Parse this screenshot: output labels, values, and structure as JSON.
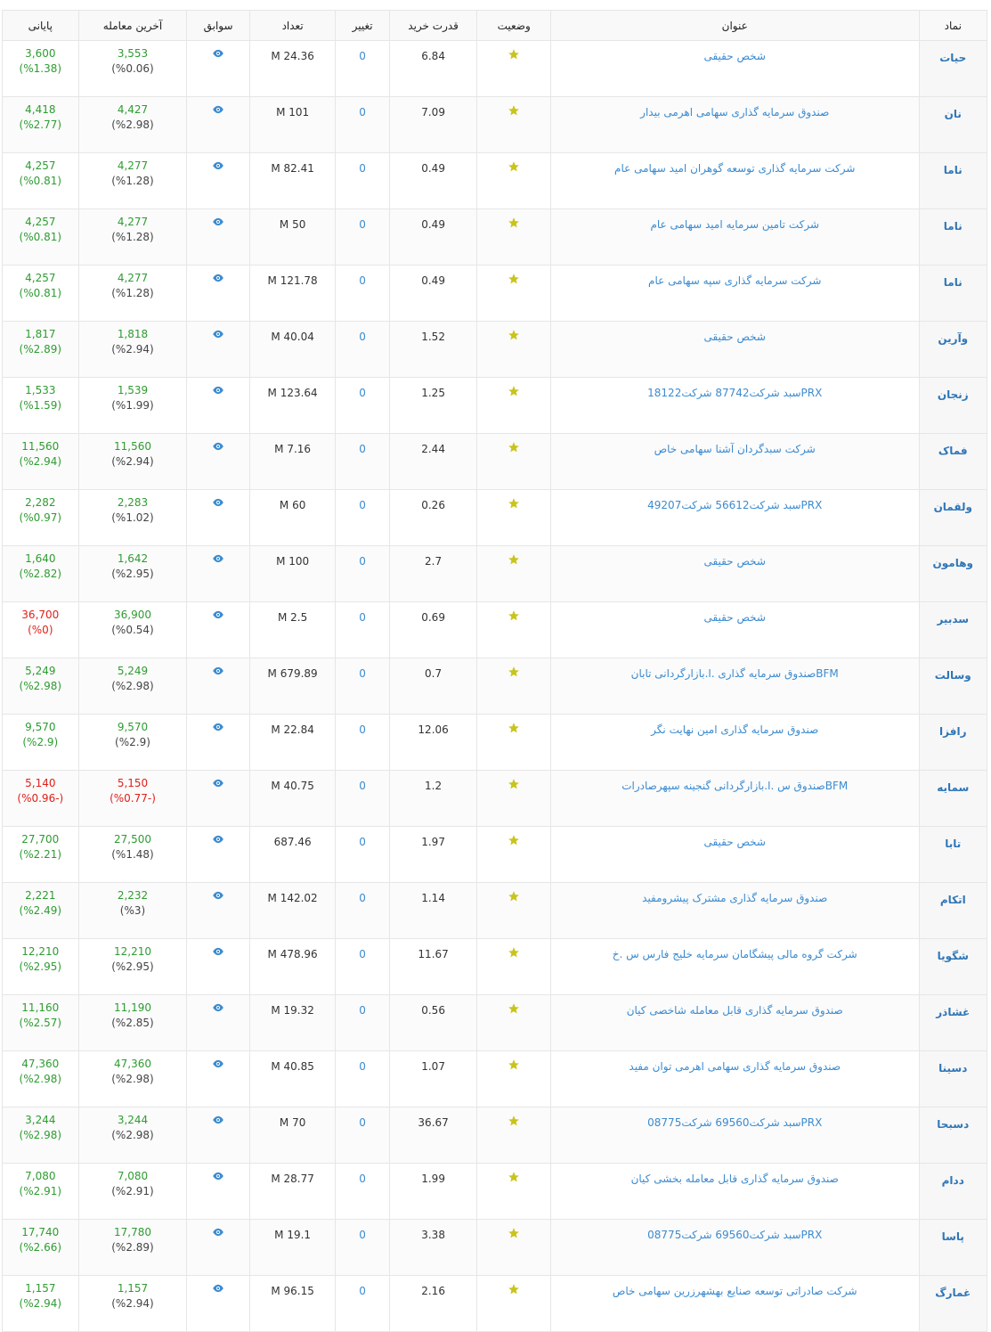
{
  "columns": {
    "symbol": "نماد",
    "title": "عنوان",
    "status": "وضعیت",
    "buy_power": "قدرت خرید",
    "change": "تغییر",
    "count": "تعداد",
    "history": "سوابق",
    "last_trade": "آخرین معامله",
    "closing": "پایانی"
  },
  "icons": {
    "status": "star-icon",
    "history": "eye-icon"
  },
  "colors": {
    "positive": "#2e9c31",
    "negative": "#e0201a",
    "link": "#3b8bd0",
    "star": "#c8c41a"
  },
  "rows": [
    {
      "symbol": "حیات",
      "title": "شخص حقیقی",
      "buy_power": "6.84",
      "change": "0",
      "count": "24.36 M",
      "last": "3,553",
      "last_pct": "(%0.06)",
      "close": "3,600",
      "close_pct": "(%1.38)",
      "close_sign": "pos"
    },
    {
      "symbol": "نان",
      "title": "صندوق سرمایه گذاری سهامی اهرمی بیدار",
      "buy_power": "7.09",
      "change": "0",
      "count": "101 M",
      "last": "4,427",
      "last_pct": "(%2.98)",
      "close": "4,418",
      "close_pct": "(%2.77)",
      "close_sign": "pos"
    },
    {
      "symbol": "ناما",
      "title": "شرکت سرمایه گذاری توسعه گوهران امید سهامی عام",
      "buy_power": "0.49",
      "change": "0",
      "count": "82.41 M",
      "last": "4,277",
      "last_pct": "(%1.28)",
      "close": "4,257",
      "close_pct": "(%0.81)",
      "close_sign": "pos"
    },
    {
      "symbol": "ناما",
      "title": "شرکت تامین سرمایه امید سهامی عام",
      "buy_power": "0.49",
      "change": "0",
      "count": "50 M",
      "last": "4,277",
      "last_pct": "(%1.28)",
      "close": "4,257",
      "close_pct": "(%0.81)",
      "close_sign": "pos"
    },
    {
      "symbol": "ناما",
      "title": "شرکت سرمایه گذاری سپه سهامی عام",
      "buy_power": "0.49",
      "change": "0",
      "count": "121.78 M",
      "last": "4,277",
      "last_pct": "(%1.28)",
      "close": "4,257",
      "close_pct": "(%0.81)",
      "close_sign": "pos"
    },
    {
      "symbol": "وآرین",
      "title": "شخص حقیقی",
      "buy_power": "1.52",
      "change": "0",
      "count": "40.04 M",
      "last": "1,818",
      "last_pct": "(%2.94)",
      "close": "1,817",
      "close_pct": "(%2.89)",
      "close_sign": "pos"
    },
    {
      "symbol": "زنجان",
      "title": "PRXسبد شرکت87742 شرکت18122",
      "buy_power": "1.25",
      "change": "0",
      "count": "123.64 M",
      "last": "1,539",
      "last_pct": "(%1.99)",
      "close": "1,533",
      "close_pct": "(%1.59)",
      "close_sign": "pos"
    },
    {
      "symbol": "فماک",
      "title": "شرکت سبدگردان آشنا سهامی خاص",
      "buy_power": "2.44",
      "change": "0",
      "count": "7.16 M",
      "last": "11,560",
      "last_pct": "(%2.94)",
      "close": "11,560",
      "close_pct": "(%2.94)",
      "close_sign": "pos"
    },
    {
      "symbol": "ولقمان",
      "title": "PRXسبد شرکت56612 شرکت49207",
      "buy_power": "0.26",
      "change": "0",
      "count": "60 M",
      "last": "2,283",
      "last_pct": "(%1.02)",
      "close": "2,282",
      "close_pct": "(%0.97)",
      "close_sign": "pos"
    },
    {
      "symbol": "وهامون",
      "title": "شخص حقیقی",
      "buy_power": "2.7",
      "change": "0",
      "count": "100 M",
      "last": "1,642",
      "last_pct": "(%2.95)",
      "close": "1,640",
      "close_pct": "(%2.82)",
      "close_sign": "pos"
    },
    {
      "symbol": "سدبیر",
      "title": "شخص حقیقی",
      "buy_power": "0.69",
      "change": "0",
      "count": "2.5 M",
      "last": "36,900",
      "last_pct": "(%0.54)",
      "close": "36,700",
      "close_pct": "(%0)",
      "close_sign": "neg"
    },
    {
      "symbol": "وسالت",
      "title": "BFMصندوق سرمایه گذاری .ا.بازارگردانی تابان",
      "buy_power": "0.7",
      "change": "0",
      "count": "679.89 M",
      "last": "5,249",
      "last_pct": "(%2.98)",
      "close": "5,249",
      "close_pct": "(%2.98)",
      "close_sign": "pos"
    },
    {
      "symbol": "رافزا",
      "title": "صندوق سرمایه گذاری امین نهایت نگر",
      "buy_power": "12.06",
      "change": "0",
      "count": "22.84 M",
      "last": "9,570",
      "last_pct": "(%2.9)",
      "close": "9,570",
      "close_pct": "(%2.9)",
      "close_sign": "pos"
    },
    {
      "symbol": "سمایه",
      "title": "BFMصندوق س .ا.بازارگردانی گنجینه سپهرصادرات",
      "buy_power": "1.2",
      "change": "0",
      "count": "40.75 M",
      "last": "5,150",
      "last_pct": "(-%0.77)",
      "close": "5,140",
      "close_pct": "(-%0.96)",
      "close_sign": "neg",
      "last_sign": "neg"
    },
    {
      "symbol": "تابا",
      "title": "شخص حقیقی",
      "buy_power": "1.97",
      "change": "0",
      "count": "687.46",
      "last": "27,500",
      "last_pct": "(%1.48)",
      "close": "27,700",
      "close_pct": "(%2.21)",
      "close_sign": "pos"
    },
    {
      "symbol": "اتکام",
      "title": "صندوق سرمایه گذاری مشترک پیشرومفید",
      "buy_power": "1.14",
      "change": "0",
      "count": "142.02 M",
      "last": "2,232",
      "last_pct": "(%3)",
      "close": "2,221",
      "close_pct": "(%2.49)",
      "close_sign": "pos"
    },
    {
      "symbol": "شگویا",
      "title": "شرکت گروه مالی پیشگامان سرمایه خلیج فارس س .خ",
      "buy_power": "11.67",
      "change": "0",
      "count": "478.96 M",
      "last": "12,210",
      "last_pct": "(%2.95)",
      "close": "12,210",
      "close_pct": "(%2.95)",
      "close_sign": "pos"
    },
    {
      "symbol": "غشاذر",
      "title": "صندوق سرمایه گذاری قابل معامله شاخصی کیان",
      "buy_power": "0.56",
      "change": "0",
      "count": "19.32 M",
      "last": "11,190",
      "last_pct": "(%2.85)",
      "close": "11,160",
      "close_pct": "(%2.57)",
      "close_sign": "pos"
    },
    {
      "symbol": "دسینا",
      "title": "صندوق سرمایه گذاری سهامی اهرمی توان مفید",
      "buy_power": "1.07",
      "change": "0",
      "count": "40.85 M",
      "last": "47,360",
      "last_pct": "(%2.98)",
      "close": "47,360",
      "close_pct": "(%2.98)",
      "close_sign": "pos"
    },
    {
      "symbol": "دسبحا",
      "title": "PRXسبد شرکت69560 شرکت08775",
      "buy_power": "36.67",
      "change": "0",
      "count": "70 M",
      "last": "3,244",
      "last_pct": "(%2.98)",
      "close": "3,244",
      "close_pct": "(%2.98)",
      "close_sign": "pos"
    },
    {
      "symbol": "ددام",
      "title": "صندوق سرمایه گذاری قابل معامله بخشی کیان",
      "buy_power": "1.99",
      "change": "0",
      "count": "28.77 M",
      "last": "7,080",
      "last_pct": "(%2.91)",
      "close": "7,080",
      "close_pct": "(%2.91)",
      "close_sign": "pos"
    },
    {
      "symbol": "پاسا",
      "title": "PRXسبد شرکت69560 شرکت08775",
      "buy_power": "3.38",
      "change": "0",
      "count": "19.1 M",
      "last": "17,780",
      "last_pct": "(%2.89)",
      "close": "17,740",
      "close_pct": "(%2.66)",
      "close_sign": "pos"
    },
    {
      "symbol": "غمارگ",
      "title": "شرکت صادراتی توسعه صنایع بهشهرزرین سهامی خاص",
      "buy_power": "2.16",
      "change": "0",
      "count": "96.15 M",
      "last": "1,157",
      "last_pct": "(%2.94)",
      "close": "1,157",
      "close_pct": "(%2.94)",
      "close_sign": "pos"
    }
  ]
}
